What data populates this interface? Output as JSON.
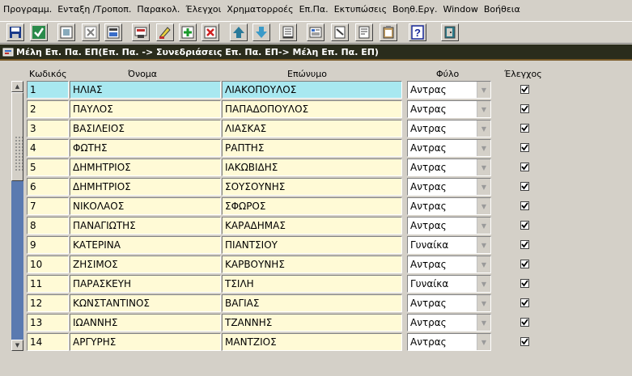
{
  "menu": [
    "Προγραμμ.",
    "Ενταξη /Τροποπ.",
    "Παρακολ.",
    "Έλεγχοι",
    "Χρηματορροές",
    "Επ.Πα.",
    "Εκτυπώσεις",
    "Βοηθ.Εργ.",
    "Window",
    "Βοήθεια"
  ],
  "window_title": "Μέλη Επ. Πα.  ΕΠ(Επ. Πα. -> Συνεδριάσεις Επ. Πα. ΕΠ-> Μέλη Επ. Πα. ΕΠ)",
  "columns": {
    "code": "Κωδικός",
    "first": "Όνομα",
    "last": "Επώνυμο",
    "gender": "Φύλο",
    "check": "Έλεγχος"
  },
  "rows": [
    {
      "code": "1",
      "first": "ΗΛΙΑΣ",
      "last": "ΛΙΑΚΟΠΟΥΛΟΣ",
      "gender": "Αντρας",
      "checked": true
    },
    {
      "code": "2",
      "first": "ΠΑΥΛΟΣ",
      "last": "ΠΑΠΑΔΟΠΟΥΛΟΣ",
      "gender": "Αντρας",
      "checked": true
    },
    {
      "code": "3",
      "first": "ΒΑΣΙΛΕΙΟΣ",
      "last": "ΛΙΑΣΚΑΣ",
      "gender": "Αντρας",
      "checked": true
    },
    {
      "code": "4",
      "first": "ΦΩΤΗΣ",
      "last": "ΡΑΠΤΗΣ",
      "gender": "Αντρας",
      "checked": true
    },
    {
      "code": "5",
      "first": "ΔΗΜΗΤΡΙΟΣ",
      "last": "ΙΑΚΩΒΙΔΗΣ",
      "gender": "Αντρας",
      "checked": true
    },
    {
      "code": "6",
      "first": "ΔΗΜΗΤΡΙΟΣ",
      "last": "ΣΟΥΣΟΥΝΗΣ",
      "gender": "Αντρας",
      "checked": true
    },
    {
      "code": "7",
      "first": "ΝΙΚΟΛΑΟΣ",
      "last": "ΣΦΩΡΟΣ",
      "gender": "Αντρας",
      "checked": true
    },
    {
      "code": "8",
      "first": "ΠΑΝΑΓΙΩΤΗΣ",
      "last": "ΚΑΡΑΔΗΜΑΣ",
      "gender": "Αντρας",
      "checked": true
    },
    {
      "code": "9",
      "first": "ΚΑΤΕΡΙΝΑ",
      "last": "ΠΙΑΝΤΣΙΟΥ",
      "gender": "Γυναίκα",
      "checked": true
    },
    {
      "code": "10",
      "first": "ΖΗΣΙΜΟΣ",
      "last": "ΚΑΡΒΟΥΝΗΣ",
      "gender": "Αντρας",
      "checked": true
    },
    {
      "code": "11",
      "first": "ΠΑΡΑΣΚΕΥΗ",
      "last": "ΤΣΙΛΗ",
      "gender": "Γυναίκα",
      "checked": true
    },
    {
      "code": "12",
      "first": "ΚΩΝΣΤΑΝΤΙΝΟΣ",
      "last": "ΒΑΓΙΑΣ",
      "gender": "Αντρας",
      "checked": true
    },
    {
      "code": "13",
      "first": "ΙΩΑΝΝΗΣ",
      "last": "ΤΖΑΝΝΗΣ",
      "gender": "Αντρας",
      "checked": true
    },
    {
      "code": "14",
      "first": "ΑΡΓΥΡΗΣ",
      "last": "ΜΑΝΤΖΙΟΣ",
      "gender": "Αντρας",
      "checked": true
    }
  ],
  "toolbar_icons": [
    "save-icon",
    "accept-icon",
    "query-icon",
    "cancel-query-icon",
    "execute-query-icon",
    "print-form-icon",
    "clear-block-icon",
    "insert-record-icon",
    "delete-record-icon",
    "previous-record-icon",
    "next-record-icon",
    "list-values-icon",
    "edit-field-icon",
    "notes-icon",
    "report-icon",
    "clipboard-icon",
    "help-icon",
    "exit-icon"
  ],
  "colors": {
    "field_bg": "#fffad6",
    "active_field_bg": "#a8e8f0",
    "titlebar_bg": "#2a2c1c",
    "scroll_track": "#5a7ab0"
  }
}
